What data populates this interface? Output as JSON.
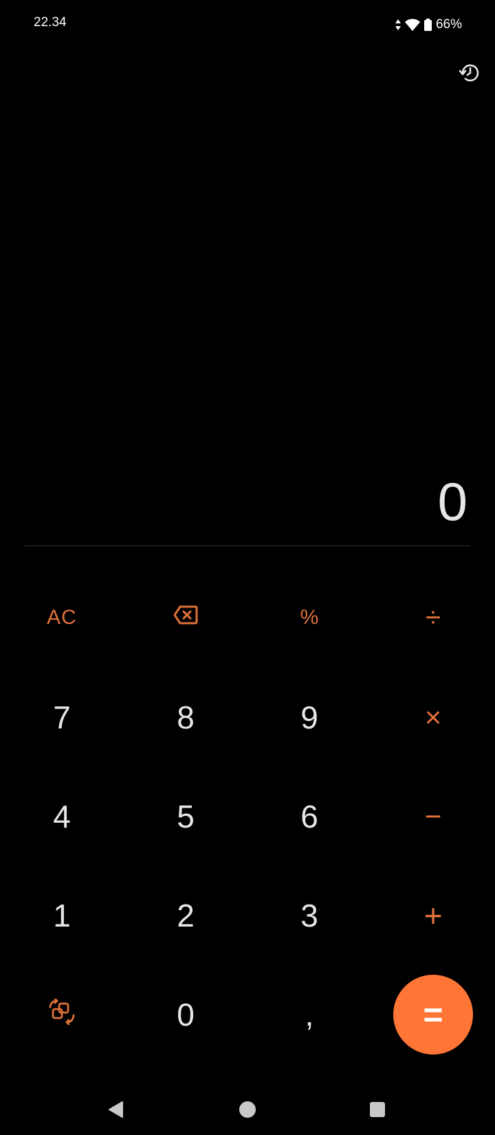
{
  "status_bar": {
    "time": "22.34",
    "battery_percent": "66%",
    "icons": [
      "data-arrows-icon",
      "wifi-icon",
      "battery-icon"
    ]
  },
  "header": {
    "history_icon": "history-icon"
  },
  "display": {
    "value": "0"
  },
  "keypad": {
    "ac": "AC",
    "backspace_icon": "backspace-icon",
    "percent": "%",
    "divide": "÷",
    "seven": "7",
    "eight": "8",
    "nine": "9",
    "multiply": "×",
    "four": "4",
    "five": "5",
    "six": "6",
    "minus": "−",
    "one": "1",
    "two": "2",
    "three": "3",
    "plus": "+",
    "convert_icon": "convert-icon",
    "zero": "0",
    "decimal": ",",
    "equals": "="
  },
  "nav_bar": {
    "icons": [
      "back-icon",
      "home-icon",
      "recents-icon"
    ]
  },
  "colors": {
    "accent": "#e0723a",
    "equals_bg": "#ff7535",
    "background": "#000000",
    "digit": "#e6e6e6"
  }
}
